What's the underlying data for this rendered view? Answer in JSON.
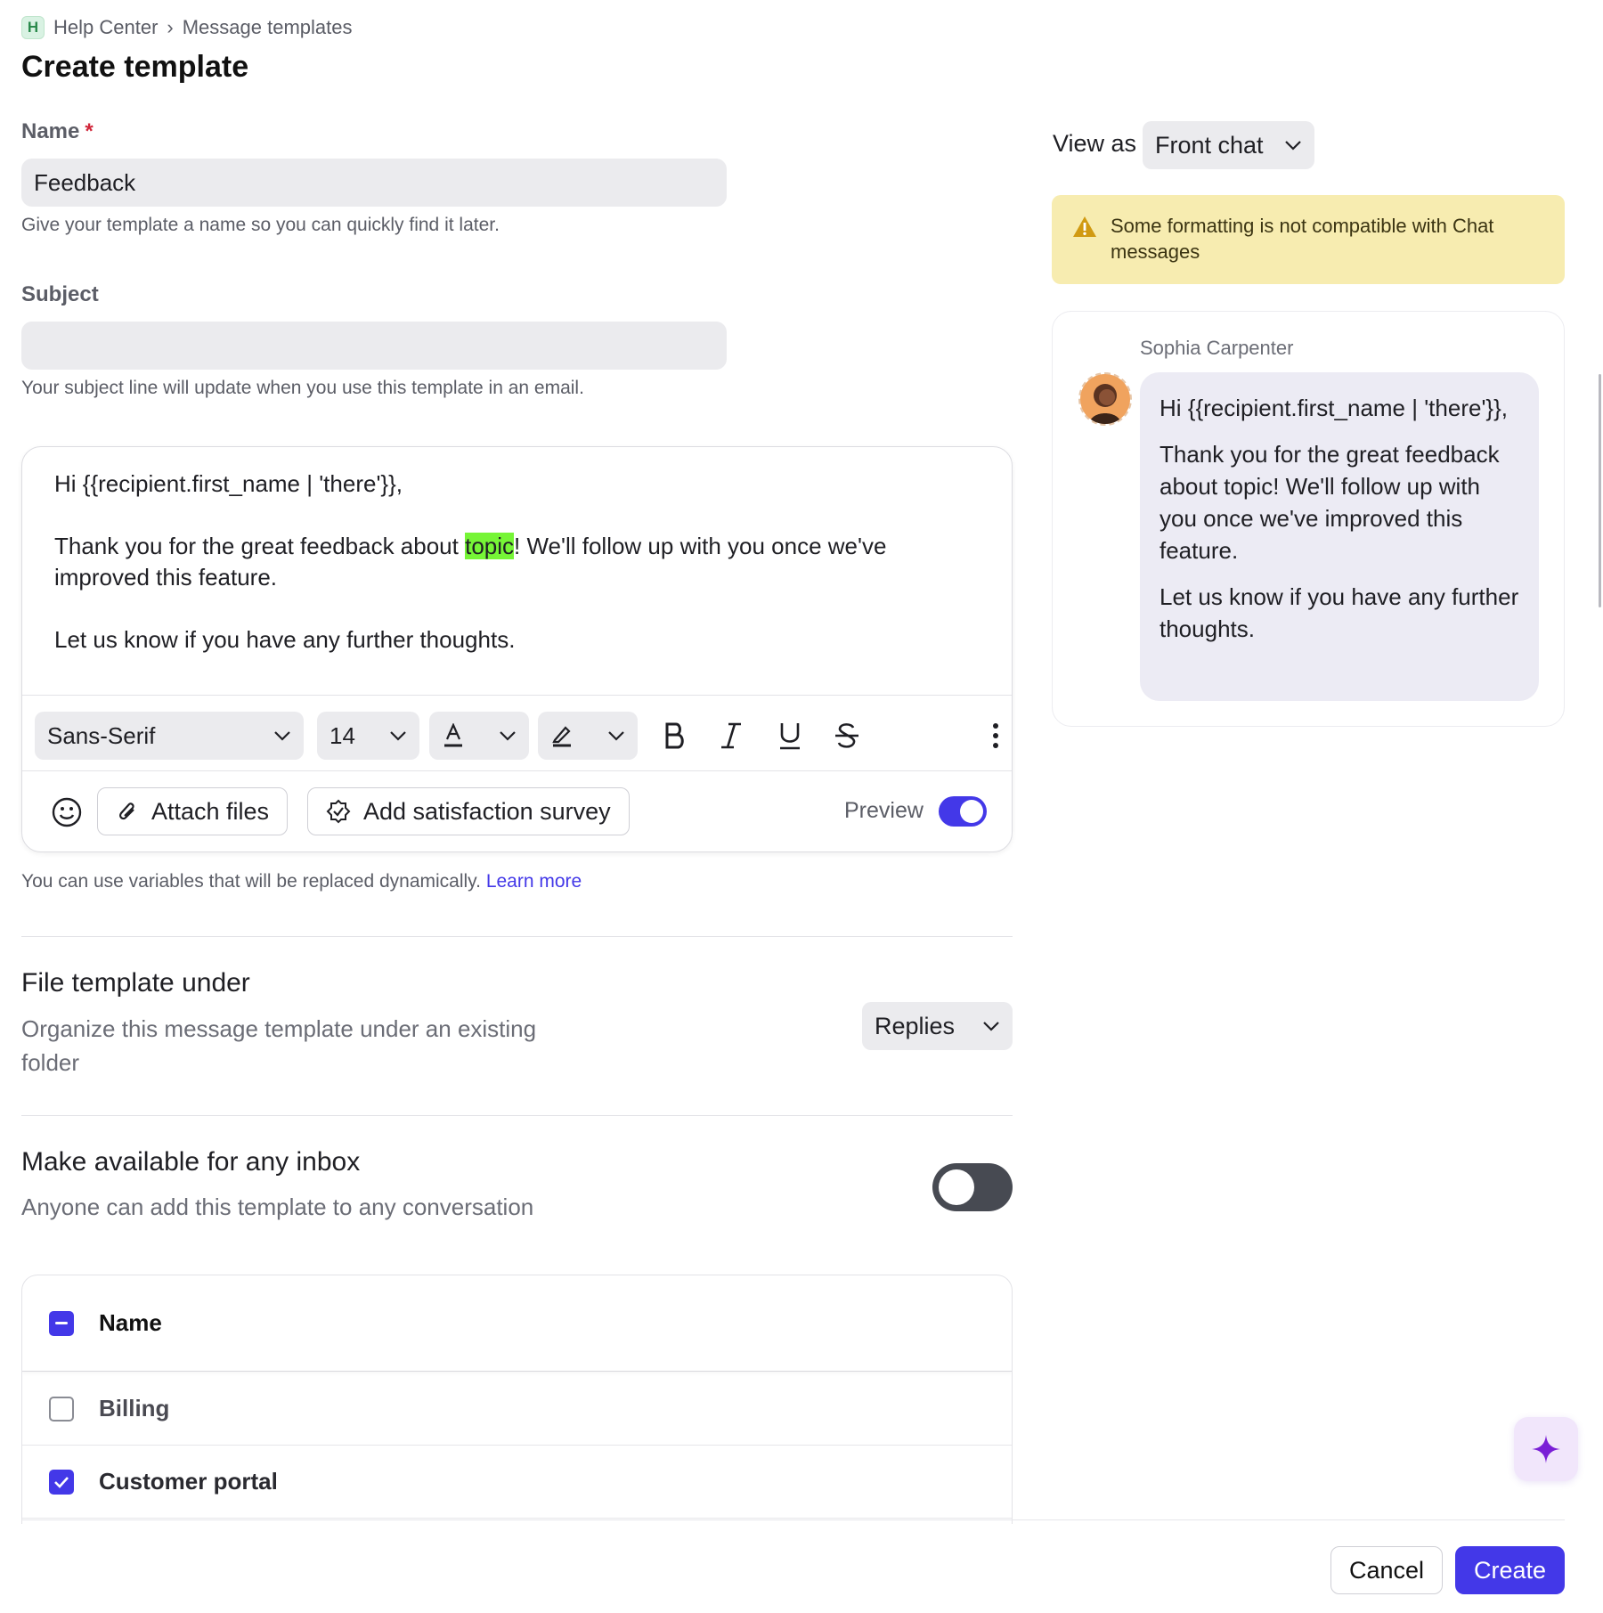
{
  "breadcrumb": {
    "badge": "H",
    "root": "Help Center",
    "separator": "›",
    "current": "Message templates"
  },
  "page": {
    "title": "Create template"
  },
  "name_field": {
    "label": "Name",
    "required_mark": "*",
    "value": "Feedback",
    "helper": "Give your template a name so you can quickly find it later."
  },
  "subject_field": {
    "label": "Subject",
    "value": "",
    "helper": "Your subject line will update when you use this template in an email."
  },
  "editor": {
    "greeting": "Hi {{recipient.first_name | 'there'}},",
    "body_before": "Thank you for the great feedback about ",
    "body_highlight": "topic",
    "body_after": "! We'll follow up with you once we've improved this feature.",
    "closing": "Let us know if you have any further thoughts.",
    "highlight_color": "#76f536",
    "toolbar": {
      "font": "Sans-Serif",
      "size": "14"
    },
    "attach_label": "Attach files",
    "survey_label": "Add satisfaction survey",
    "preview_label": "Preview",
    "preview_on": true
  },
  "variables_note": {
    "text": "You can use variables that will be replaced dynamically.",
    "link": "Learn more"
  },
  "file_under": {
    "title": "File template under",
    "description": "Organize this message template under an existing folder",
    "selected": "Replies"
  },
  "availability": {
    "title": "Make available for any inbox",
    "description": "Anyone can add this template to any conversation",
    "enabled": false
  },
  "inbox_table": {
    "header": "Name",
    "rows": [
      {
        "name": "Billing",
        "checked": false
      },
      {
        "name": "Customer portal",
        "checked": true
      }
    ]
  },
  "preview_panel": {
    "view_as_label": "View as",
    "view_as_value": "Front chat",
    "warning": "Some formatting is not compatible with Chat messages",
    "sender": "Sophia Carpenter",
    "message_greeting": "Hi {{recipient.first_name | 'there'}},",
    "message_body": "Thank you for the great feedback about topic! We'll follow up with you once we've improved this feature.",
    "message_closing": "Let us know if you have any further thoughts."
  },
  "footer": {
    "cancel": "Cancel",
    "create": "Create"
  },
  "colors": {
    "accent": "#4338e8",
    "warning_bg": "#f7ecb0",
    "input_bg": "#ebebee",
    "fab_bg": "#f1e6fb",
    "fab_icon": "#7a1fd6"
  },
  "icons": [
    "chevron-right-icon",
    "chevron-down-icon",
    "text-color-icon",
    "highlight-icon",
    "bold-icon",
    "italic-icon",
    "underline-icon",
    "strikethrough-icon",
    "more-vertical-icon",
    "emoji-icon",
    "paperclip-icon",
    "badge-check-icon",
    "warning-icon",
    "sparkle-icon"
  ]
}
